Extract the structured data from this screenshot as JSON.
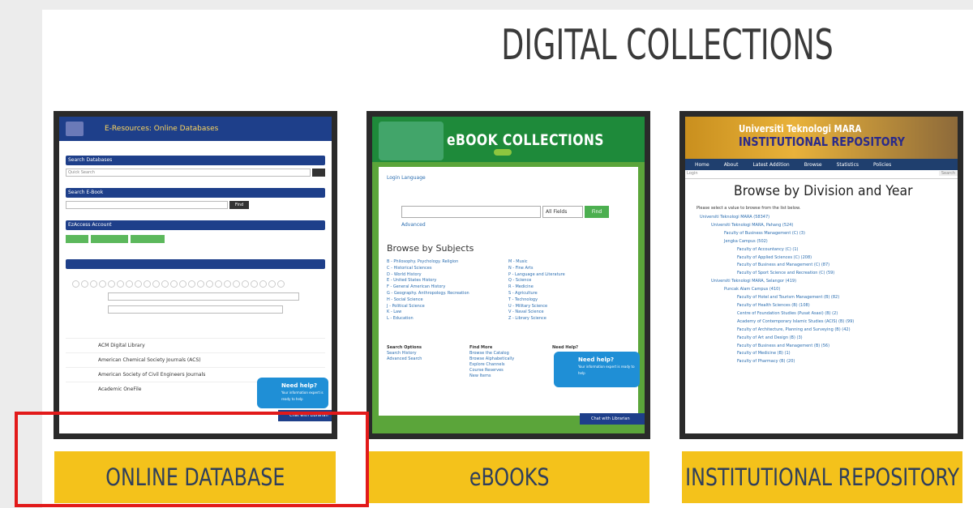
{
  "page": {
    "title": "DIGITAL COLLECTIONS"
  },
  "cards": [
    {
      "label": "ONLINE DATABASE",
      "preview": {
        "header_title": "E-Resources: Online Databases",
        "search_db_label": "Search Databases",
        "search_db_placeholder": "Quick Search",
        "search_ebook_label": "Search E-Book",
        "find_label": "Find",
        "ezaccess_label": "EzAccess Account",
        "list_items": [
          "ACM Digital Library",
          "American Chemical Society Journals (ACS)",
          "American Society of Civil Engineers Journals",
          "Academic OneFile"
        ],
        "chat_title": "Need help?",
        "chat_sub": "Your information expert is ready to help",
        "chat_bar": "Chat with Librarian"
      }
    },
    {
      "label": "eBOOKS",
      "preview": {
        "banner": "eBOOK COLLECTIONS",
        "login_link": "Login  Language",
        "all_fields": "All Fields",
        "find_label": "Find",
        "advanced": "Advanced",
        "browse_heading": "Browse by Subjects",
        "subjects_left": [
          "B - Philosophy. Psychology. Religion",
          "C - Historical Sciences",
          "D - World History",
          "E - United States History",
          "F - General American History",
          "G - Geography. Anthropology. Recreation",
          "H - Social Science",
          "J - Political Science",
          "K - Law",
          "L - Education"
        ],
        "subjects_right": [
          "M - Music",
          "N - Fine Arts",
          "P - Language and Literature",
          "Q - Science",
          "R - Medicine",
          "S - Agriculture",
          "T - Technology",
          "U - Military Science",
          "V - Naval Science",
          "Z - Library Science"
        ],
        "foot_search_title": "Search Options",
        "foot_search": [
          "Search History",
          "Advanced Search"
        ],
        "foot_find_title": "Find More",
        "foot_find": [
          "Browse the Catalog",
          "Browse Alphabetically",
          "Explore Channels",
          "Course Reserves",
          "New Items"
        ],
        "foot_help_title": "Need Help?",
        "chat_title": "Need help?",
        "chat_sub": "Your information expert is ready to help",
        "chat_bar": "Chat with Librarian"
      }
    },
    {
      "label": "INSTITUTIONAL REPOSITORY",
      "preview": {
        "banner_top": "Universiti Teknologi MARA",
        "banner_bottom": "INSTITUTIONAL REPOSITORY",
        "nav": [
          "Home",
          "About",
          "Latest Addition",
          "Browse",
          "Statistics",
          "Policies"
        ],
        "login": "Login",
        "search_btn": "Search",
        "heading": "Browse by Division and Year",
        "intro": "Please select a value to browse from the list below.",
        "tree": [
          "Universiti Teknologi MARA (58347)",
          "Universiti Teknologi MARA, Pahang (524)",
          "Faculty of Business Management (C) (3)",
          "Jengka Campus (502)",
          "Faculty of Accountancy (C) (1)",
          "Faculty of Applied Sciences (C) (208)",
          "Faculty of Business and Management (C) (87)",
          "Faculty of Sport Science and Recreation (C) (59)",
          "Universiti Teknologi MARA, Selangor (419)",
          "Puncak Alam Campus (410)",
          "Faculty of Hotel and Tourism Management (B) (82)",
          "Faculty of Health Sciences (B) (108)",
          "Centre of Foundation Studies (Pusat Asasi) (B) (2)",
          "Academy of Contemporary Islamic Studies (ACIS) (B) (99)",
          "Faculty of Architecture, Planning and Surveying (B) (42)",
          "Faculty of Art and Design (B) (3)",
          "Faculty of Business and Management (B) (56)",
          "Faculty of Medicine (B) (1)",
          "Faculty of Pharmacy (B) (20)"
        ]
      }
    }
  ],
  "colors": {
    "label_bg": "#f4c21b",
    "label_text": "#2f3f5c",
    "highlight": "#e21a1a"
  }
}
